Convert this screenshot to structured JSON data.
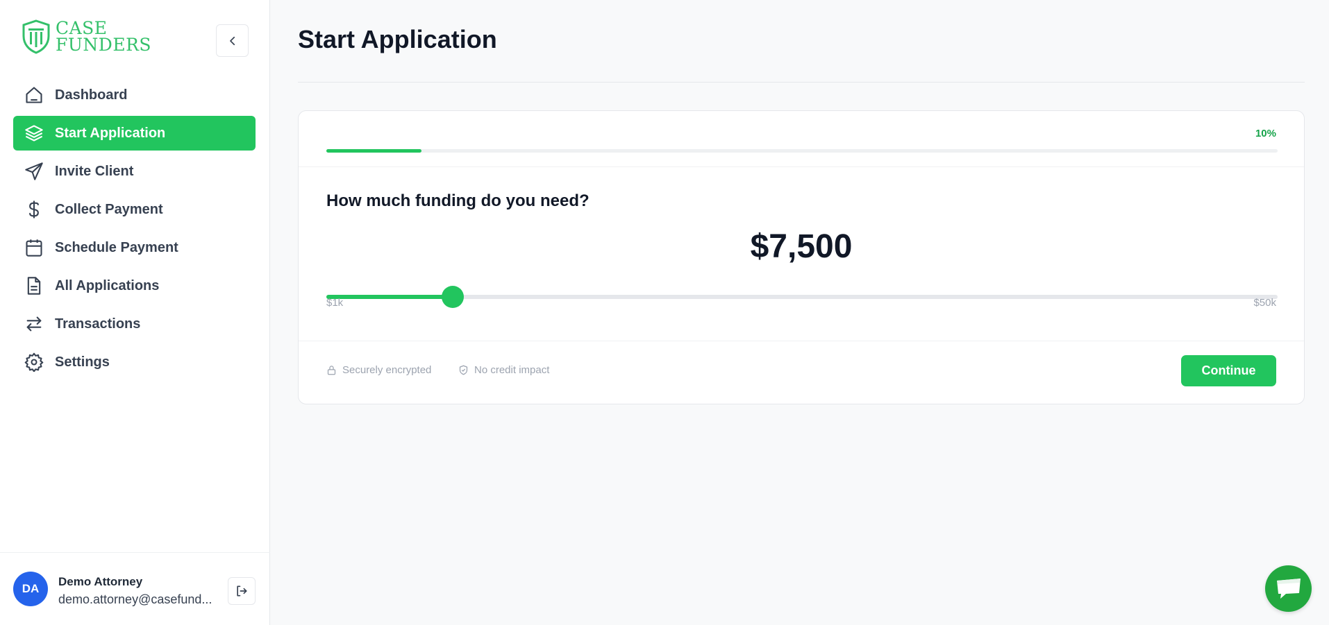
{
  "brand": {
    "line1": "CASE",
    "line2": "FUNDERS",
    "accent": "#34c06a"
  },
  "sidebar": {
    "items": [
      {
        "label": "Dashboard",
        "icon": "home-icon",
        "active": false
      },
      {
        "label": "Start Application",
        "icon": "layers-icon",
        "active": true
      },
      {
        "label": "Invite Client",
        "icon": "send-icon",
        "active": false
      },
      {
        "label": "Collect Payment",
        "icon": "dollar-icon",
        "active": false
      },
      {
        "label": "Schedule Payment",
        "icon": "calendar-icon",
        "active": false
      },
      {
        "label": "All Applications",
        "icon": "file-text-icon",
        "active": false
      },
      {
        "label": "Transactions",
        "icon": "arrows-swap-icon",
        "active": false
      },
      {
        "label": "Settings",
        "icon": "gear-icon",
        "active": false
      }
    ]
  },
  "user": {
    "initials": "DA",
    "name": "Demo Attorney",
    "email": "demo.attorney@casefund..."
  },
  "main": {
    "title": "Start Application",
    "progress": {
      "percent_label": "10%",
      "fraction": 0.1
    },
    "question": "How much funding do you need?",
    "amount": "$7,500",
    "slider": {
      "min_label": "$1k",
      "max_label": "$50k",
      "fraction": 0.1327
    },
    "badges": {
      "secure": "Securely encrypted",
      "credit": "No credit impact"
    },
    "continue_label": "Continue"
  },
  "colors": {
    "primary": "#22c55e",
    "avatar": "#2563eb",
    "chat": "#22a83f"
  }
}
